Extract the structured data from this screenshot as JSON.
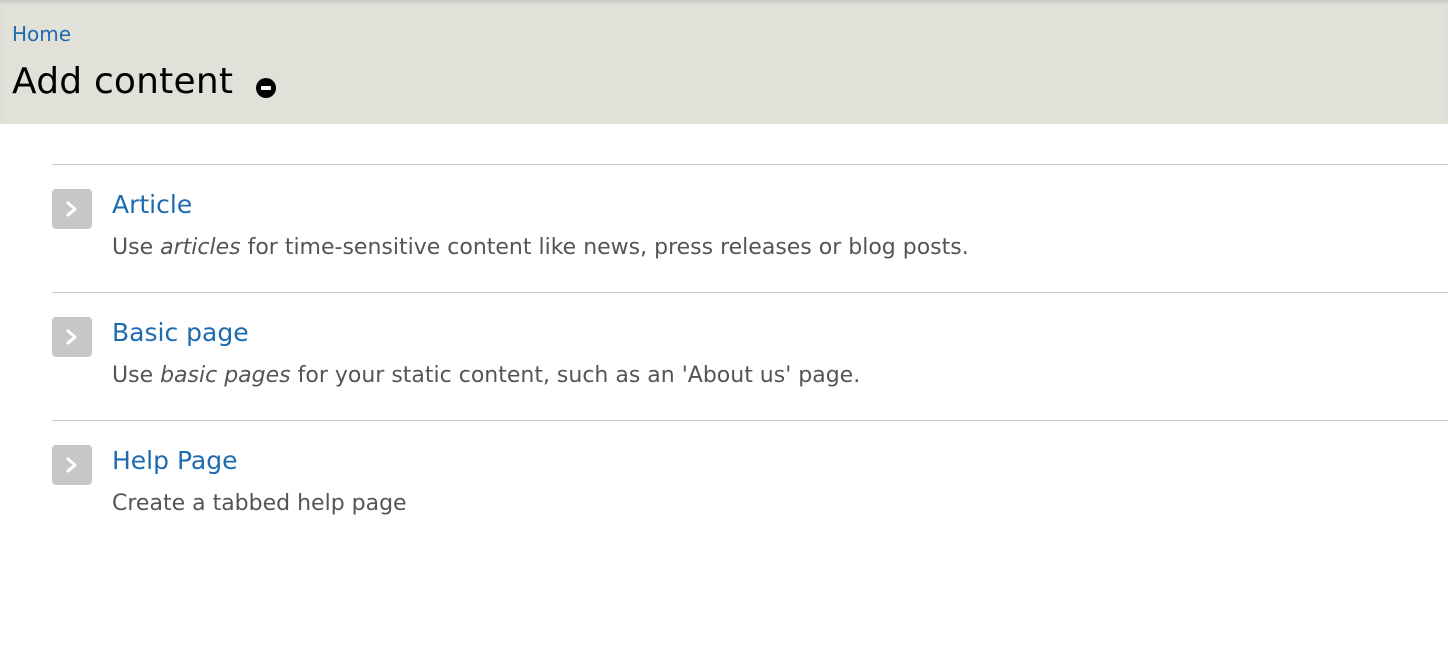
{
  "breadcrumb": {
    "home": "Home"
  },
  "page": {
    "title": "Add content"
  },
  "content_types": [
    {
      "title": "Article",
      "desc_before": "Use ",
      "desc_em": "articles",
      "desc_after": " for time-sensitive content like news, press releases or blog posts."
    },
    {
      "title": "Basic page",
      "desc_before": "Use ",
      "desc_em": "basic pages",
      "desc_after": " for your static content, such as an 'About us' page."
    },
    {
      "title": "Help Page",
      "desc_before": "Create a tabbed help page",
      "desc_em": "",
      "desc_after": ""
    }
  ],
  "icons": {
    "shortcut": "remove-shortcut-icon",
    "item": "chevron-right-icon"
  },
  "colors": {
    "header_bg": "#e1e0d9",
    "link": "#1e6bb0",
    "description": "#555555",
    "icon_bg": "#c7c7c7"
  }
}
